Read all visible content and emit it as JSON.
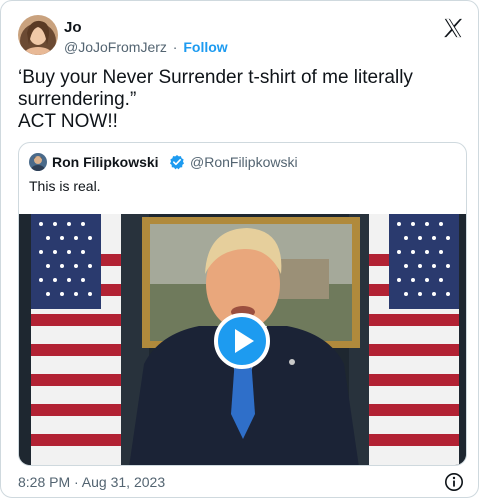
{
  "author": {
    "name": "Jo",
    "handle": "@JoJoFromJerz",
    "separator": "·",
    "follow_label": "Follow"
  },
  "tweet": {
    "line1": "‘Buy your Never Surrender t-shirt of me literally",
    "line2": "surrendering.”",
    "line3": "ACT NOW!!"
  },
  "quoted": {
    "name": "Ron Filipkowski",
    "handle": "@RonFilipkowski",
    "text": "This is real."
  },
  "footer": {
    "time": "8:28 PM · Aug 31, 2023"
  },
  "colors": {
    "accent": "#1d9bf0",
    "muted": "#536471",
    "border": "#cfd9de"
  },
  "icons": [
    "x-logo-icon",
    "verified-badge-icon",
    "play-icon",
    "info-icon"
  ]
}
